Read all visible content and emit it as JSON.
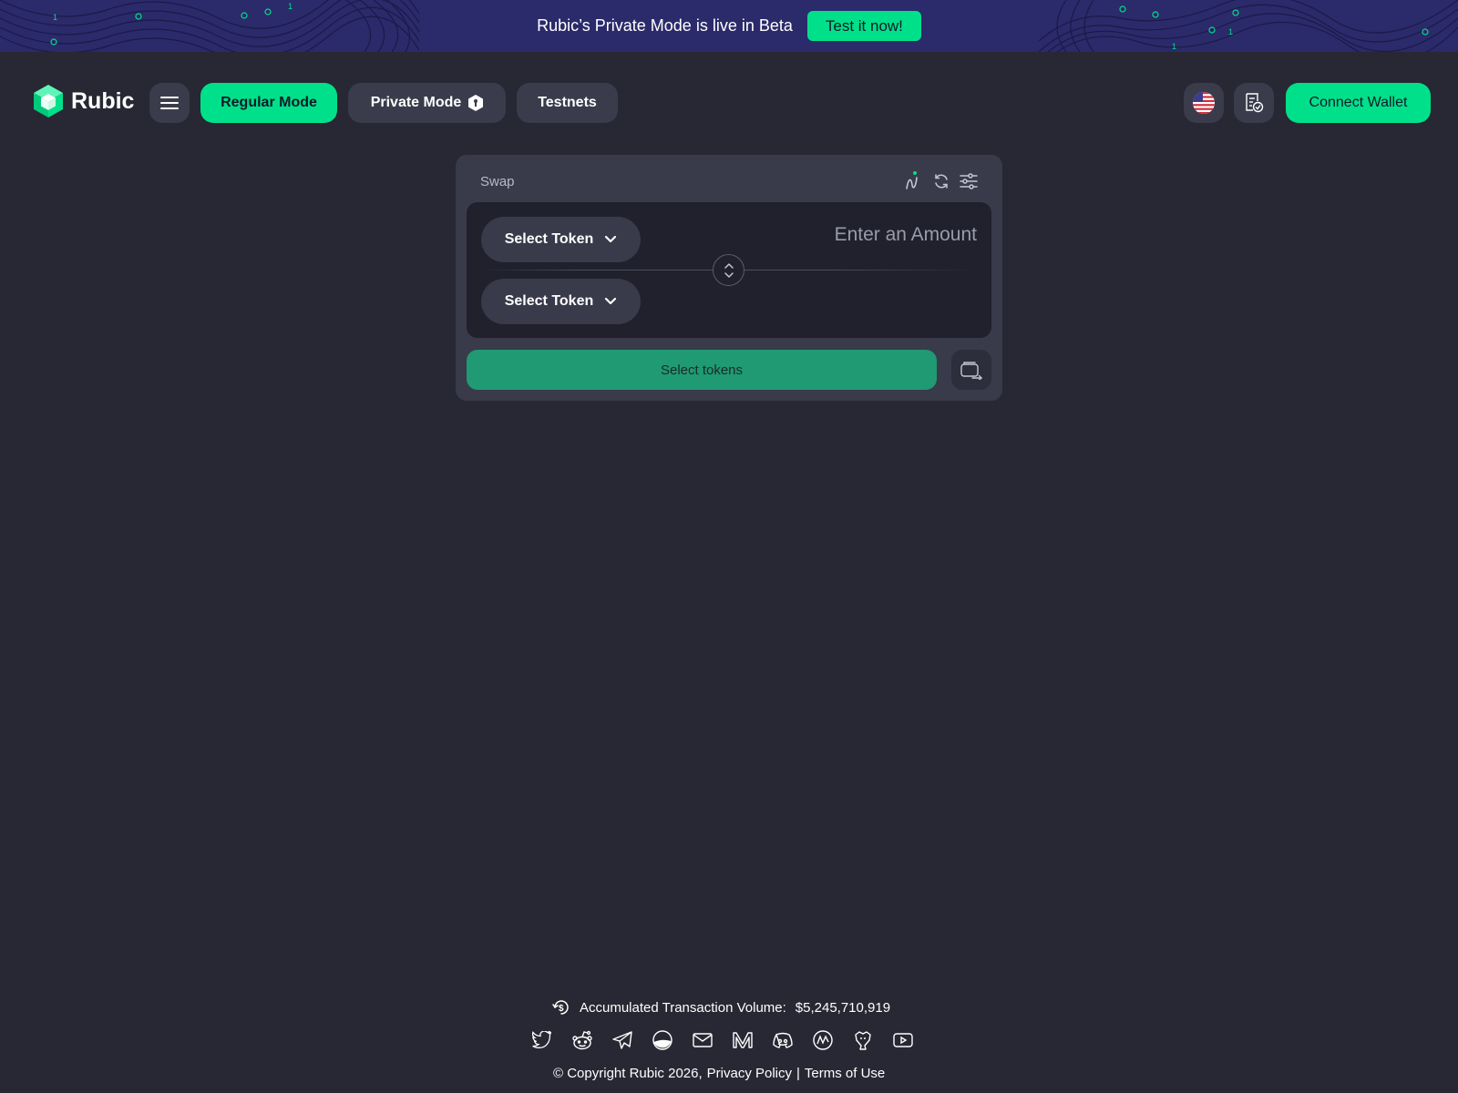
{
  "banner": {
    "message": "Rubic’s Private Mode is live in Beta",
    "cta": "Test it now!"
  },
  "header": {
    "logo_text": "Rubic",
    "regular_mode": "Regular Mode",
    "private_mode": "Private Mode",
    "testnets": "Testnets",
    "connect_wallet": "Connect Wallet"
  },
  "swap": {
    "title": "Swap",
    "from_token": "Select Token",
    "to_token": "Select Token",
    "amount_placeholder": "Enter an Amount",
    "action_label": "Select tokens"
  },
  "footer": {
    "volume_label": "Accumulated Transaction Volume:",
    "volume_value": "$5,245,710,919",
    "copyright": "© Copyright Rubic 2026,",
    "privacy": "Privacy Policy",
    "separator": "|",
    "terms": "Terms of Use",
    "socials": [
      "twitter-icon",
      "reddit-icon",
      "telegram-icon",
      "coingecko-icon",
      "mail-icon",
      "medium-icon",
      "discord-icon",
      "coinmarketcap-icon",
      "github-icon",
      "youtube-icon"
    ]
  },
  "colors": {
    "accent": "#00e08a",
    "background": "#272833",
    "banner": "#2b2a6a",
    "card": "#393a4a"
  }
}
